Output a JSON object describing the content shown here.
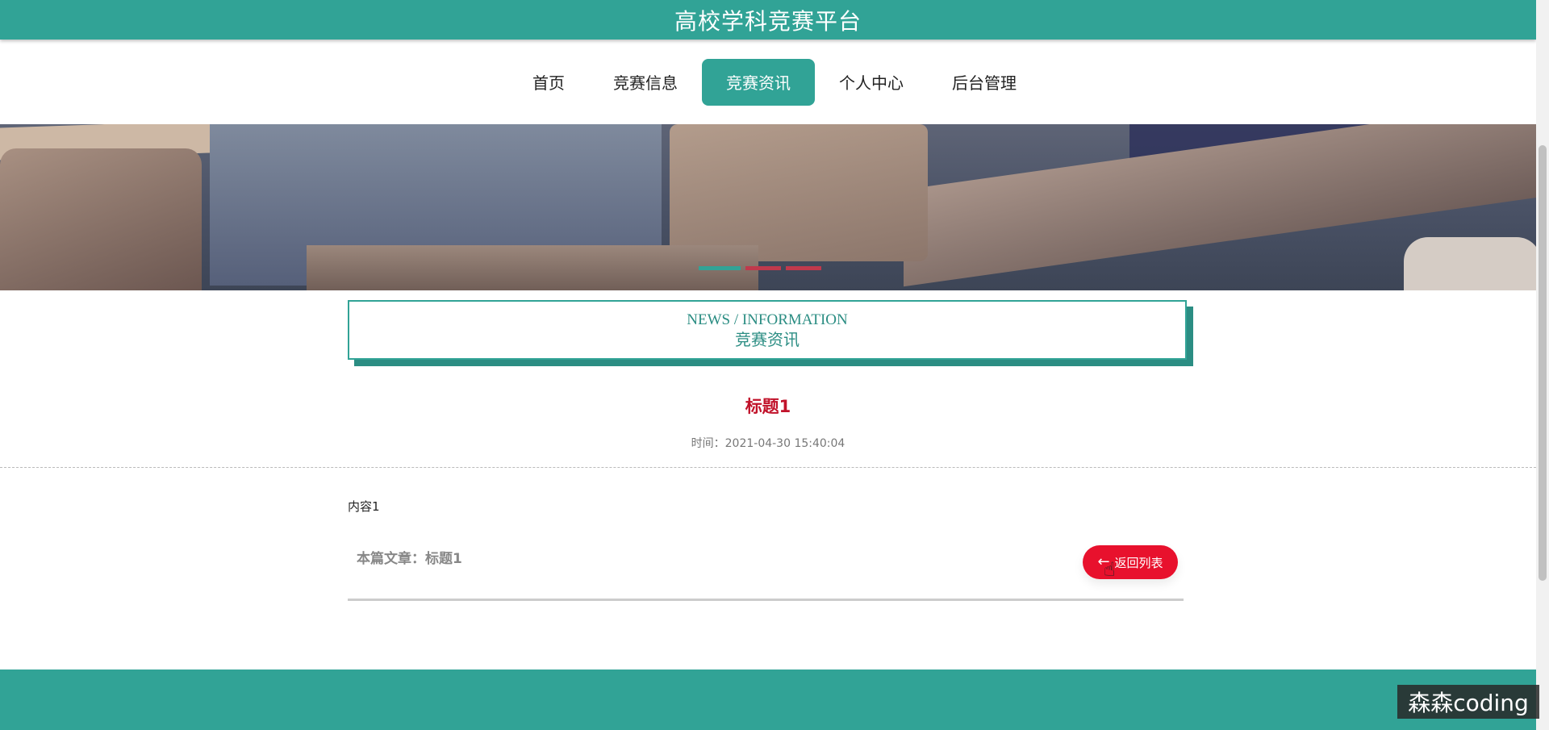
{
  "header": {
    "site_title": "高校学科竞赛平台"
  },
  "nav": {
    "items": [
      {
        "label": "首页"
      },
      {
        "label": "竞赛信息"
      },
      {
        "label": "竞赛资讯"
      },
      {
        "label": "个人中心"
      },
      {
        "label": "后台管理"
      }
    ],
    "active_index": 2
  },
  "section": {
    "title_en": "NEWS / INFORMATION",
    "title_cn": "竞赛资讯"
  },
  "article": {
    "title": "标题1",
    "time": "时间：2021-04-30 15:40:04",
    "content": "内容1",
    "current_label": "本篇文章：标题1",
    "back_label": "返回列表"
  },
  "watermark": "森森coding",
  "colors": {
    "primary": "#31a396",
    "accent_red": "#e8112d",
    "title_red": "#c1122a"
  }
}
